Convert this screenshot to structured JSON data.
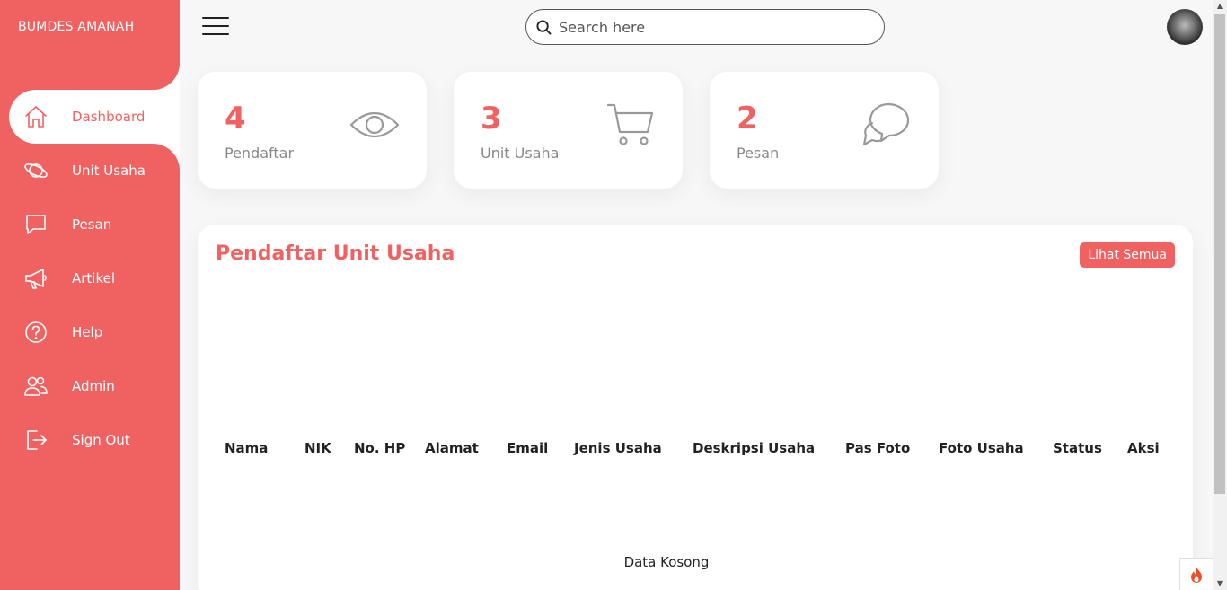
{
  "brand": "BUMDES AMANAH",
  "sidebar": {
    "items": [
      {
        "label": "Dashboard",
        "icon": "home-icon",
        "active": true
      },
      {
        "label": "Unit Usaha",
        "icon": "planet-icon"
      },
      {
        "label": "Pesan",
        "icon": "chat-icon"
      },
      {
        "label": "Artikel",
        "icon": "megaphone-icon"
      },
      {
        "label": "Help",
        "icon": "help-circle-icon"
      },
      {
        "label": "Admin",
        "icon": "people-icon"
      },
      {
        "label": "Sign Out",
        "icon": "log-out-icon"
      }
    ]
  },
  "topbar": {
    "search_placeholder": "Search here"
  },
  "cards": [
    {
      "number": "4",
      "label": "Pendaftar",
      "icon": "eye-icon"
    },
    {
      "number": "3",
      "label": "Unit Usaha",
      "icon": "cart-icon"
    },
    {
      "number": "2",
      "label": "Pesan",
      "icon": "chat-bubbles-icon"
    }
  ],
  "table": {
    "title": "Pendaftar Unit Usaha",
    "view_all_label": "Lihat Semua",
    "columns": [
      "Nama",
      "NIK",
      "No. HP",
      "Alamat",
      "Email",
      "Jenis Usaha",
      "Deskripsi Usaha",
      "Pas Foto",
      "Foto Usaha",
      "Status",
      "Aksi"
    ],
    "empty_text": "Data Kosong"
  },
  "colors": {
    "accent": "#f06262",
    "background": "#f7f7f7",
    "card": "#ffffff",
    "muted_text": "#888888"
  }
}
